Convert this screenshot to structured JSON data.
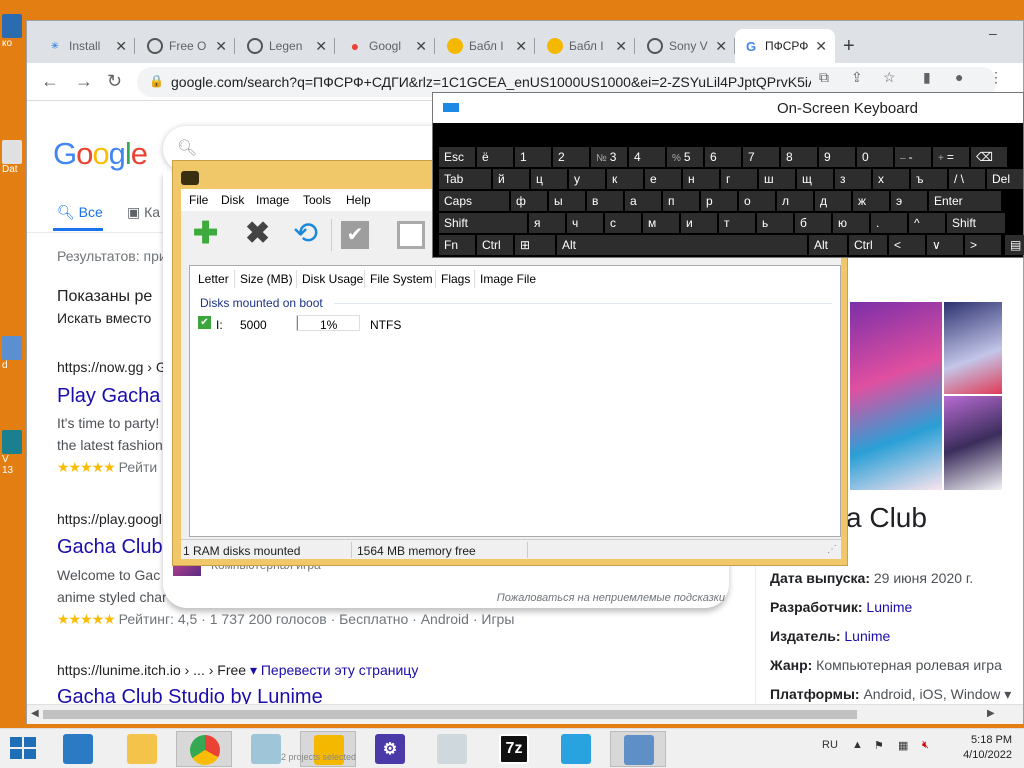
{
  "desktop": {
    "labels": [
      "ко",
      "Dat",
      "d",
      "V",
      "13"
    ]
  },
  "browser": {
    "tabs": [
      {
        "label": "Install",
        "favicon": "puzzle-icon"
      },
      {
        "label": "Free O",
        "favicon": "globe-icon"
      },
      {
        "label": "Legen",
        "favicon": "globe-icon"
      },
      {
        "label": "Googl",
        "favicon": "maps-pin-icon"
      },
      {
        "label": "Бабл I",
        "favicon": "brawl-icon"
      },
      {
        "label": "Бабл I",
        "favicon": "brawl-icon"
      },
      {
        "label": "Sony V",
        "favicon": "globe-icon"
      },
      {
        "label": "ПФСРФ",
        "favicon": "google-icon",
        "active": true
      }
    ],
    "new_tab": "+",
    "controls": {
      "minimize": "–"
    },
    "url": "google.com/search?q=ПФСРФ+СДГИ&rlz=1C1GCEA_enUS1000US1000&ei=2-ZSYuLil4PJptQPrvK5iA...",
    "google": {
      "logo": "Google",
      "logo_colors": [
        "#4285f4",
        "#ea4335",
        "#fbbc05",
        "#4285f4",
        "#34a853",
        "#ea4335"
      ],
      "tabs": [
        {
          "label": "Все",
          "active": true
        },
        {
          "label": "Ка"
        }
      ],
      "results_count": "Результатов: при",
      "shown_for": "Показаны ре",
      "search_instead": "Искать вместо",
      "results": [
        {
          "cite": "https://now.gg › G",
          "title": "Play Gacha",
          "snippet": [
            "It's time to party!",
            "the latest fashion"
          ],
          "stars": "★★★★★",
          "rating": "Рейти"
        },
        {
          "cite": "https://play.googl",
          "title": "Gacha Club",
          "snippet": [
            "Welcome to Gac",
            "anime styled char"
          ],
          "stars": "★★★★★",
          "rating": "Рейтинг: 4,5 · 1 737 200 голосов · Бесплатно · Android · Игры"
        },
        {
          "cite": "https://lunime.itch.io › ... › Free",
          "translate": "▾ Перевести эту страницу",
          "title": "Gacha Club Studio by Lunime"
        }
      ],
      "dropdown": {
        "item": "Компьютерная игра",
        "report": "Пожаловаться на неприемлемые подсказки"
      },
      "knowledge_panel": {
        "title": "a Club",
        "rows": [
          {
            "label": "Дата выпуска:",
            "value": "29 июня 2020 г."
          },
          {
            "label": "Разработчик:",
            "value": "Lunime",
            "link": true
          },
          {
            "label": "Издатель:",
            "value": "Lunime",
            "link": true
          },
          {
            "label": "Жанр:",
            "value": "Компьютерная ролевая игра"
          },
          {
            "label": "Платформы:",
            "value": "Android, iOS, Window ▾"
          }
        ]
      }
    }
  },
  "osk": {
    "title": "On-Screen Keyboard",
    "keys": {
      "r1": [
        [
          "Esc",
          ""
        ],
        [
          "ё",
          ""
        ],
        [
          "1",
          ""
        ],
        [
          "2",
          ""
        ],
        [
          "3",
          "№"
        ],
        [
          "4",
          ""
        ],
        [
          "5",
          "%"
        ],
        [
          "6",
          ""
        ],
        [
          "7",
          ""
        ],
        [
          "8",
          ""
        ],
        [
          "9",
          ""
        ],
        [
          "0",
          ""
        ],
        [
          "-",
          "–"
        ],
        [
          "=",
          "+"
        ],
        [
          "⌫",
          ""
        ]
      ],
      "r2": [
        "Tab",
        "й",
        "ц",
        "у",
        "к",
        "е",
        "н",
        "г",
        "ш",
        "щ",
        "з",
        "х",
        "ъ",
        "/ \\",
        "Del"
      ],
      "r3": [
        "Caps",
        "ф",
        "ы",
        "в",
        "а",
        "п",
        "р",
        "о",
        "л",
        "д",
        "ж",
        "э",
        "Enter"
      ],
      "r4": [
        "Shift",
        "я",
        "ч",
        "с",
        "м",
        "и",
        "т",
        "ь",
        "б",
        "ю",
        ".",
        "^",
        "Shift"
      ],
      "r5": [
        "Fn",
        "Ctrl",
        "⊞",
        "Alt",
        "Alt",
        "Ctrl",
        "<",
        "∨",
        ">",
        "▤"
      ]
    }
  },
  "imdisk": {
    "menu": [
      "File",
      "Disk",
      "Image",
      "Tools",
      "Help"
    ],
    "columns": [
      "Letter",
      "Size (MB)",
      "Disk Usage",
      "File System",
      "Flags",
      "Image File"
    ],
    "group": "Disks mounted on boot",
    "row": {
      "letter": "I:",
      "size": "5000",
      "usage": "1%",
      "usage_fraction": 0.01,
      "fs": "NTFS"
    },
    "status": {
      "left": "1 RAM disks mounted",
      "right": "1564 MB memory free"
    }
  },
  "taskbar": {
    "apps": [
      {
        "name": "server-manager-icon",
        "label": ""
      },
      {
        "name": "file-explorer-icon",
        "label": ""
      },
      {
        "name": "chrome-icon",
        "label": ""
      },
      {
        "name": "notepad-icon",
        "label": ""
      },
      {
        "name": "imdisk-icon",
        "label": "2 projects selected"
      },
      {
        "name": "settings-gear-icon",
        "label": ""
      },
      {
        "name": "task-manager-icon",
        "label": ""
      },
      {
        "name": "7zip-icon",
        "label": "7z"
      },
      {
        "name": "folder-icon",
        "label": ""
      },
      {
        "name": "keyboard-icon",
        "label": ""
      }
    ],
    "lang": "RU",
    "time": "5:18 PM",
    "date": "4/10/2022"
  }
}
